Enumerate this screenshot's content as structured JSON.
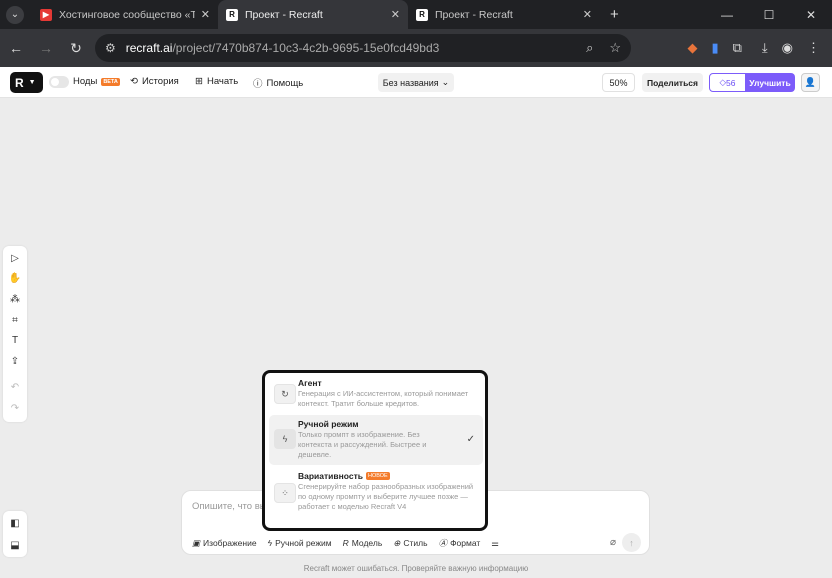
{
  "browser": {
    "tabs": [
      {
        "title": "Хостинговое сообщество «Tim",
        "favicon": "youtube-icon",
        "color": "#e53935"
      },
      {
        "title": "Проект - Recraft",
        "favicon": "recraft-icon"
      },
      {
        "title": "Проект - Recraft",
        "favicon": "recraft-icon"
      }
    ],
    "url_host": "recraft.ai",
    "url_path": "/project/7470b874-10c3-4c2b-9695-15e0fcd49bd3"
  },
  "topbar": {
    "nodes_label": "Ноды",
    "beta_badge": "BETA",
    "history_label": "История",
    "start_label": "Начать",
    "help_label": "Помощь",
    "project_title": "Без названия",
    "zoom": "50%",
    "share_label": "Поделиться",
    "credits": "56",
    "upgrade_label": "Улучшить"
  },
  "dropdown": {
    "options": [
      {
        "name": "Агент",
        "desc": "Генерация с ИИ-ассистентом, который понимает контекст. Тратит больше кредитов."
      },
      {
        "name": "Ручной режим",
        "desc": "Только промпт в изображение. Без контекста и рассуждений. Быстрее и дешевле.",
        "selected": true
      },
      {
        "name": "Вариативность",
        "badge": "НОВОЕ",
        "desc": "Сгенерируйте набор разнообразных изображений по одному промпту и выберите лучшее позже — работает с моделью Recraft V4"
      }
    ]
  },
  "prompt": {
    "placeholder": "Опишите, что вы",
    "image_label": "Изображение",
    "mode_label": "Ручной режим",
    "model_label": "Модель",
    "style_label": "Стиль",
    "format_label": "Формат"
  },
  "disclaimer": "Recraft может ошибаться. Проверяйте важную информацию",
  "colors": {
    "accent": "#7c5cfa",
    "beta": "#f47b2a"
  }
}
